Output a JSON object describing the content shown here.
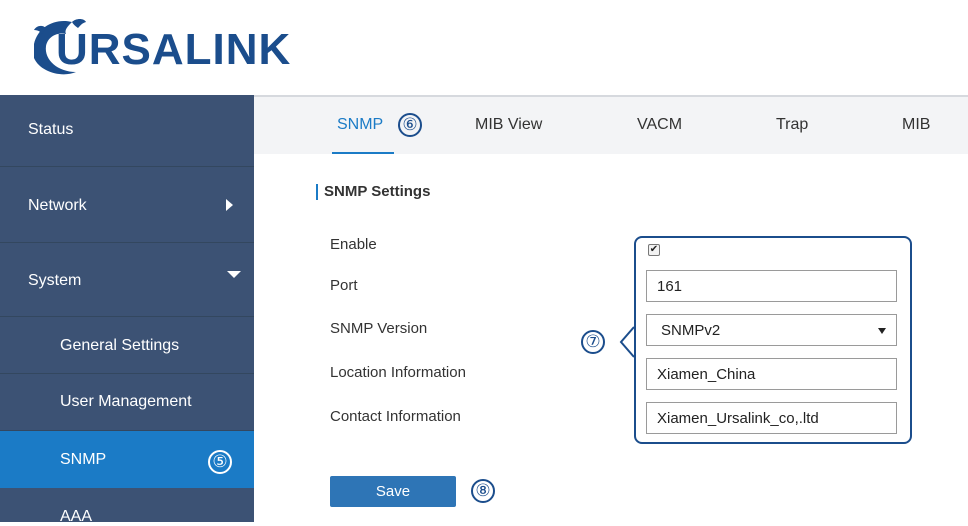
{
  "brand": {
    "logo_text": "URSALINK",
    "colors": {
      "brand_blue": "#1b4d8c",
      "accent": "#1b7bc6",
      "sidebar": "#3c5274",
      "button": "#2e75b6"
    }
  },
  "sidebar": {
    "items": [
      {
        "label": "Status"
      },
      {
        "label": "Network",
        "icon": "chevron-right-icon"
      },
      {
        "label": "System",
        "icon": "chevron-down-icon"
      },
      {
        "label": "General Settings"
      },
      {
        "label": "User Management"
      },
      {
        "label": "SNMP",
        "active": true,
        "annotation": "⑤"
      },
      {
        "label": "AAA"
      }
    ]
  },
  "tabs": {
    "items": [
      {
        "label": "SNMP",
        "active": true,
        "annotation": "⑥"
      },
      {
        "label": "MIB View"
      },
      {
        "label": "VACM"
      },
      {
        "label": "Trap"
      },
      {
        "label": "MIB"
      }
    ]
  },
  "snmp_settings": {
    "title": "SNMP Settings",
    "annotation": "⑦",
    "enable": {
      "label": "Enable",
      "checked": true
    },
    "port": {
      "label": "Port",
      "value": "161"
    },
    "version": {
      "label": "SNMP Version",
      "selected": "SNMPv2"
    },
    "location": {
      "label": "Location Information",
      "value": "Xiamen_China"
    },
    "contact": {
      "label": "Contact Information",
      "value": "Xiamen_Ursalink_co,.ltd"
    }
  },
  "actions": {
    "save_label": "Save",
    "save_annotation": "⑧"
  }
}
